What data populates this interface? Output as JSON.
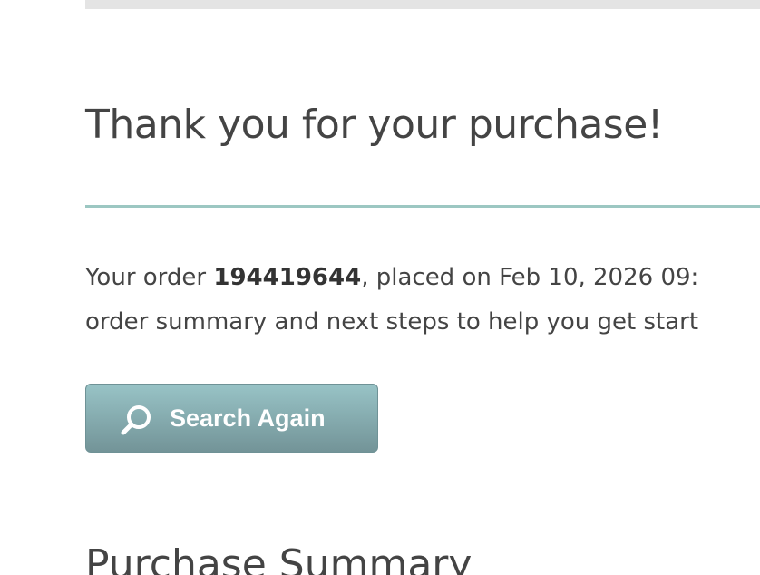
{
  "confirmation": {
    "heading": "Thank you for your purchase!",
    "order_prefix": "Your order ",
    "order_number": "194419644",
    "order_suffix": ", placed on Feb 10, 2026 09:",
    "order_line2": "order summary and next steps to help you get start"
  },
  "actions": {
    "search_again_label": "Search Again",
    "search_icon": "search-icon"
  },
  "summary": {
    "heading": "Purchase Summary"
  },
  "colors": {
    "rule": "#9cc7c2",
    "button_top": "#98c3c6",
    "button_bottom": "#739498",
    "text": "#444444"
  }
}
